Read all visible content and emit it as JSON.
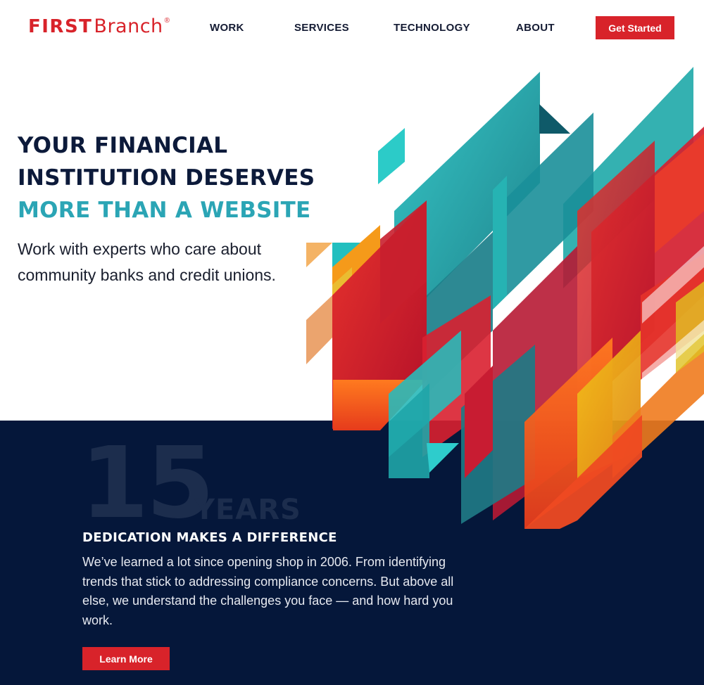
{
  "header": {
    "logo_first": "FIRST",
    "logo_branch": "Branch",
    "logo_reg": "®",
    "nav": [
      "WORK",
      "SERVICES",
      "TECHNOLOGY",
      "ABOUT"
    ],
    "cta_label": "Get Started"
  },
  "hero": {
    "heading_line1": "YOUR FINANCIAL",
    "heading_line2": "INSTITUTION DESERVES",
    "heading_line3": "MORE THAN A WEBSITE",
    "subtext": "Work with experts who care about community banks and credit unions."
  },
  "stats": {
    "number": "15",
    "unit": "YEARS",
    "title": "DEDICATION MAKES A DIFFERENCE",
    "body": "We’ve learned a lot since opening shop in 2006. From identifying trends that stick to addressing compliance concerns. But above all else, we understand the challenges you face — and how hard you work.",
    "button_label": "Learn More"
  },
  "colors": {
    "brand_red": "#d8232a",
    "navy": "#05173a",
    "teal": "#2ba5b5",
    "heading_dark": "#0c1a3a"
  }
}
